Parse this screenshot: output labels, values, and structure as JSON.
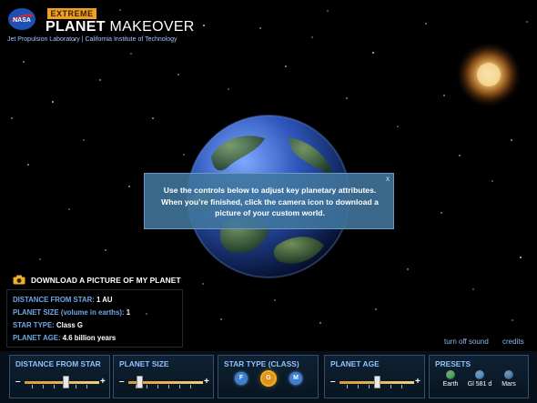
{
  "app": {
    "badge": "EXTREME",
    "title_bold": "PLANET",
    "title_rest": " MAKEOVER",
    "subtitle": "Jet Propulsion Laboratory | California Institute of Technology"
  },
  "popup": {
    "text": "Use the controls below to adjust key planetary attributes. When you’re finished, click the camera icon to download a picture of your custom world.",
    "close": "x"
  },
  "download": {
    "label": "DOWNLOAD A PICTURE OF MY PLANET"
  },
  "info": {
    "distance_label": "DISTANCE FROM STAR:",
    "distance_value": "1 AU",
    "size_label": "PLANET SIZE (volume in earths):",
    "size_value": "1",
    "type_label": "STAR TYPE:",
    "type_value": "Class G",
    "age_label": "PLANET AGE:",
    "age_value": "4.6 billion years"
  },
  "links": {
    "sound": "turn off sound",
    "credits": "credits"
  },
  "controls": {
    "distance": {
      "title": "DISTANCE FROM STAR",
      "minus": "–",
      "plus": "+",
      "level": 0.55
    },
    "size": {
      "title": "PLANET SIZE",
      "minus": "–",
      "plus": "+",
      "level": 0.15
    },
    "star_type": {
      "title": "STAR TYPE (CLASS)",
      "options": [
        "F",
        "G",
        "M"
      ],
      "selected": "G",
      "colors": {
        "F": "#3e7fd3",
        "G": "#e1921b",
        "M": "#3e7fd3"
      }
    },
    "age": {
      "title": "PLANET AGE",
      "minus": "–",
      "plus": "+",
      "level": 0.5
    },
    "presets": {
      "title": "PRESETS",
      "items": [
        {
          "name": "Earth",
          "color": "#3fae45"
        },
        {
          "name": "Gl 581 d",
          "color": "#4b8fcf"
        },
        {
          "name": "Mars",
          "color": "#4b7db0"
        }
      ]
    }
  },
  "colors": {
    "accent_blue": "#6fa6e6",
    "slider_orange": "#e0a441",
    "star_orange": "#d98a32"
  }
}
